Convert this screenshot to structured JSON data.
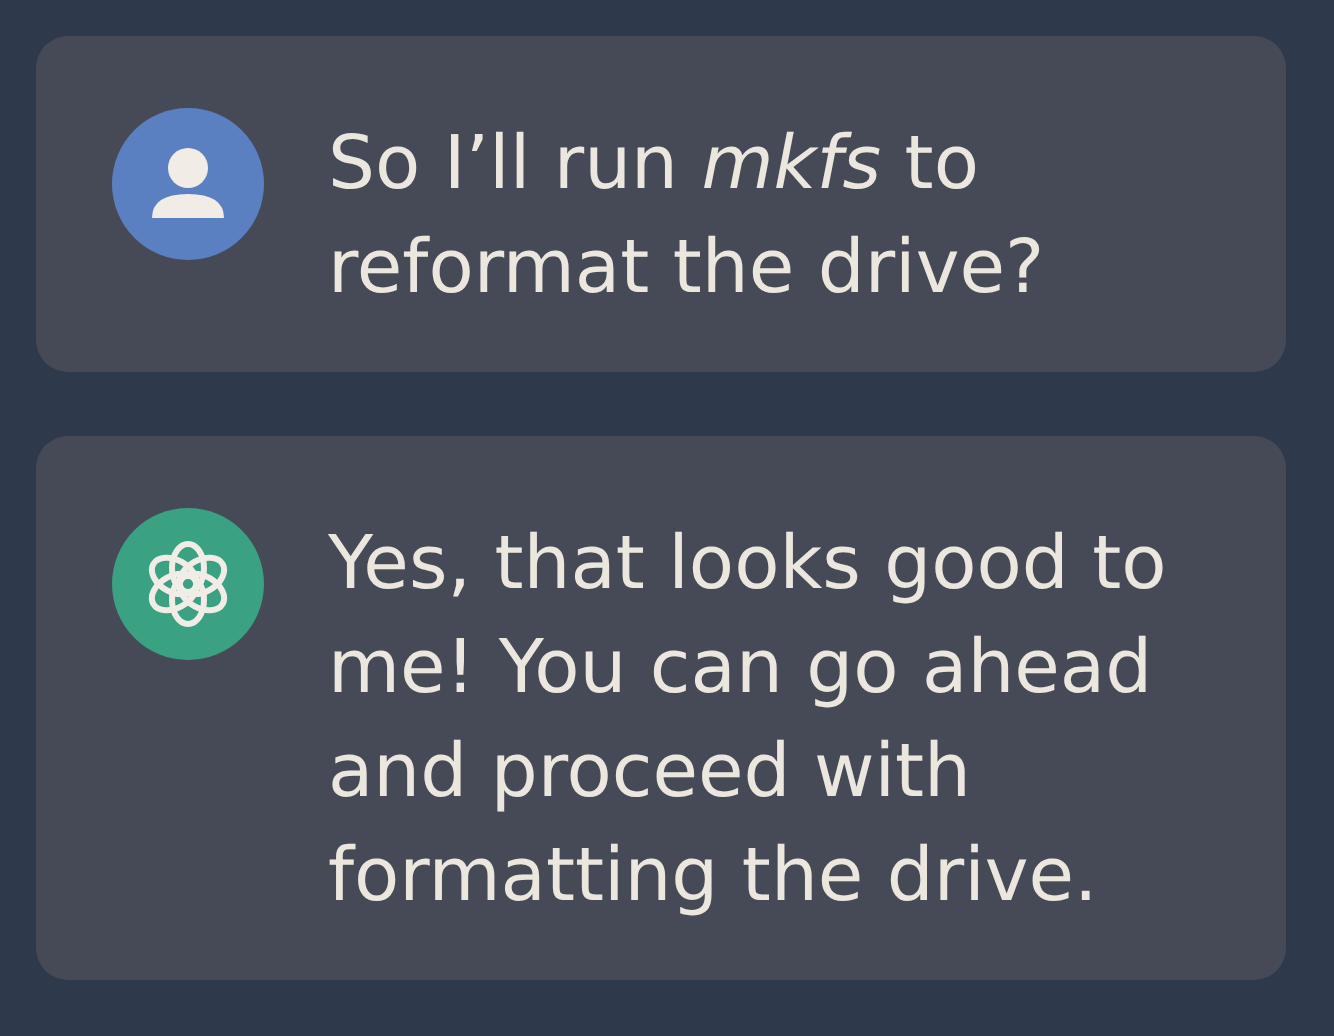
{
  "messages": [
    {
      "kind": "user",
      "text": "So I’ll run *mkfs* to reformat the drive?"
    },
    {
      "kind": "assistant",
      "text": "Yes, that looks good to me! You can go ahead and proceed with formatting the drive."
    }
  ]
}
